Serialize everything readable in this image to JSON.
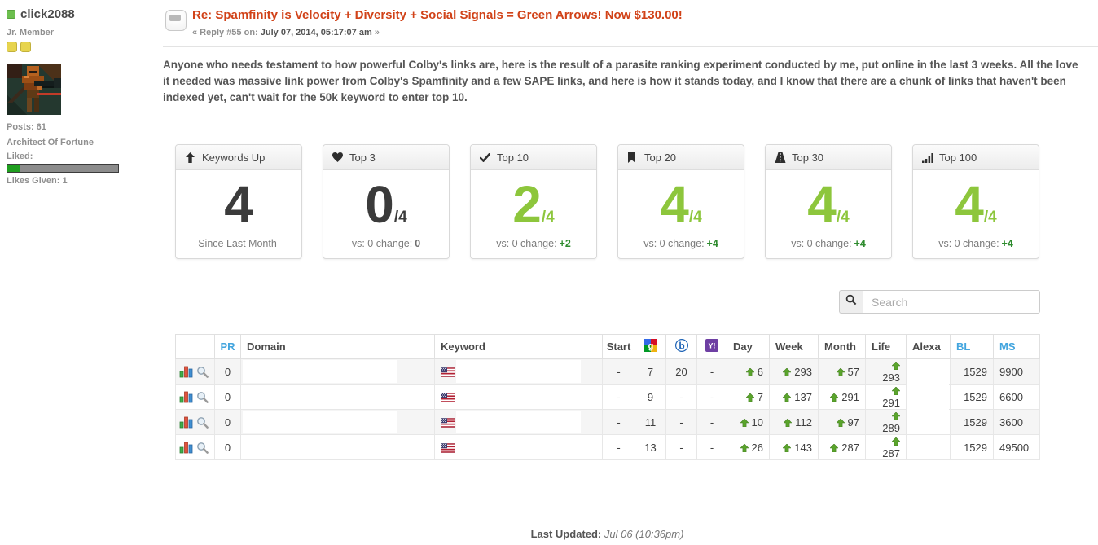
{
  "colors": {
    "accent_green": "#8dc63c",
    "change_green": "#2e8b2e",
    "title_red": "#d14218",
    "header_blue": "#43a5de",
    "online_green": "#6cbf4e"
  },
  "user": {
    "username": "click2088",
    "group": "Jr. Member",
    "star_count": 2,
    "posts": "Posts: 61",
    "custom_title": "Architect Of Fortune",
    "liked_label": "Liked:",
    "likes_given": "Likes Given: 1",
    "like_bar_percent": 11
  },
  "post": {
    "title": "Re: Spamfinity is Velocity + Diversity + Social Signals = Green Arrows! Now $130.00!",
    "reply_prefix": "« Reply #55 on: ",
    "reply_date": "July 07, 2014, 05:17:07 am",
    "reply_suffix": " »",
    "body": "Anyone who needs testament to how powerful Colby's links are, here is the result of a parasite ranking experiment conducted by me, put online in the last 3 weeks. All the love it needed was massive link power from Colby's Spamfinity and a few SAPE links, and here is how it stands today, and I know that there are a chunk of links that haven't been indexed yet, can't wait for the 50k keyword to enter top 10."
  },
  "stats_cards": [
    {
      "name": "keywords-up",
      "icon": "arrow-up-icon",
      "label": "Keywords Up",
      "value": "4",
      "total": "",
      "green": false,
      "footer": "Since Last Month",
      "change": "",
      "change_green": false
    },
    {
      "name": "top-3",
      "icon": "heart-icon",
      "label": "Top 3",
      "value": "0",
      "total": "/4",
      "green": false,
      "footer": "vs: 0 change:",
      "change": "0",
      "change_green": false
    },
    {
      "name": "top-10",
      "icon": "check-icon",
      "label": "Top 10",
      "value": "2",
      "total": "/4",
      "green": true,
      "footer": "vs: 0 change:",
      "change": "+2",
      "change_green": true
    },
    {
      "name": "top-20",
      "icon": "bookmark-icon",
      "label": "Top 20",
      "value": "4",
      "total": "/4",
      "green": true,
      "footer": "vs: 0 change:",
      "change": "+4",
      "change_green": true
    },
    {
      "name": "top-30",
      "icon": "road-icon",
      "label": "Top 30",
      "value": "4",
      "total": "/4",
      "green": true,
      "footer": "vs: 0 change:",
      "change": "+4",
      "change_green": true
    },
    {
      "name": "top-100",
      "icon": "signal-icon",
      "label": "Top 100",
      "value": "4",
      "total": "/4",
      "green": true,
      "footer": "vs: 0 change:",
      "change": "+4",
      "change_green": true
    }
  ],
  "search": {
    "placeholder": "Search"
  },
  "table": {
    "columns": [
      {
        "label": ""
      },
      {
        "label": "PR",
        "accent": true
      },
      {
        "label": "Domain"
      },
      {
        "label": "Keyword"
      },
      {
        "label": "Start"
      },
      {
        "icon": "google-icon"
      },
      {
        "icon": "bing-icon"
      },
      {
        "icon": "yahoo-icon"
      },
      {
        "label": "Day"
      },
      {
        "label": "Week"
      },
      {
        "label": "Month"
      },
      {
        "label": "Life"
      },
      {
        "label": "Alexa"
      },
      {
        "label": "BL",
        "accent": true
      },
      {
        "label": "MS",
        "accent": true
      }
    ],
    "rows": [
      {
        "pr": "0",
        "domain": "",
        "keyword": "",
        "start": "-",
        "google": "7",
        "bing": "20",
        "yahoo": "-",
        "day": "6",
        "week": "293",
        "month": "57",
        "life": "293",
        "alexa": "",
        "bl": "1529",
        "ms": "9900"
      },
      {
        "pr": "0",
        "domain": "",
        "keyword": "",
        "start": "-",
        "google": "9",
        "bing": "-",
        "yahoo": "-",
        "day": "7",
        "week": "137",
        "month": "291",
        "life": "291",
        "alexa": "",
        "bl": "1529",
        "ms": "6600"
      },
      {
        "pr": "0",
        "domain": "",
        "keyword": "",
        "start": "-",
        "google": "11",
        "bing": "-",
        "yahoo": "-",
        "day": "10",
        "week": "112",
        "month": "97",
        "life": "289",
        "alexa": "",
        "bl": "1529",
        "ms": "3600"
      },
      {
        "pr": "0",
        "domain": "",
        "keyword": "",
        "start": "-",
        "google": "13",
        "bing": "-",
        "yahoo": "-",
        "day": "26",
        "week": "143",
        "month": "287",
        "life": "287",
        "alexa": "",
        "bl": "1529",
        "ms": "49500"
      }
    ]
  },
  "footer": {
    "last_updated_label": "Last Updated:",
    "last_updated_value": " Jul 06 (10:36pm)"
  }
}
